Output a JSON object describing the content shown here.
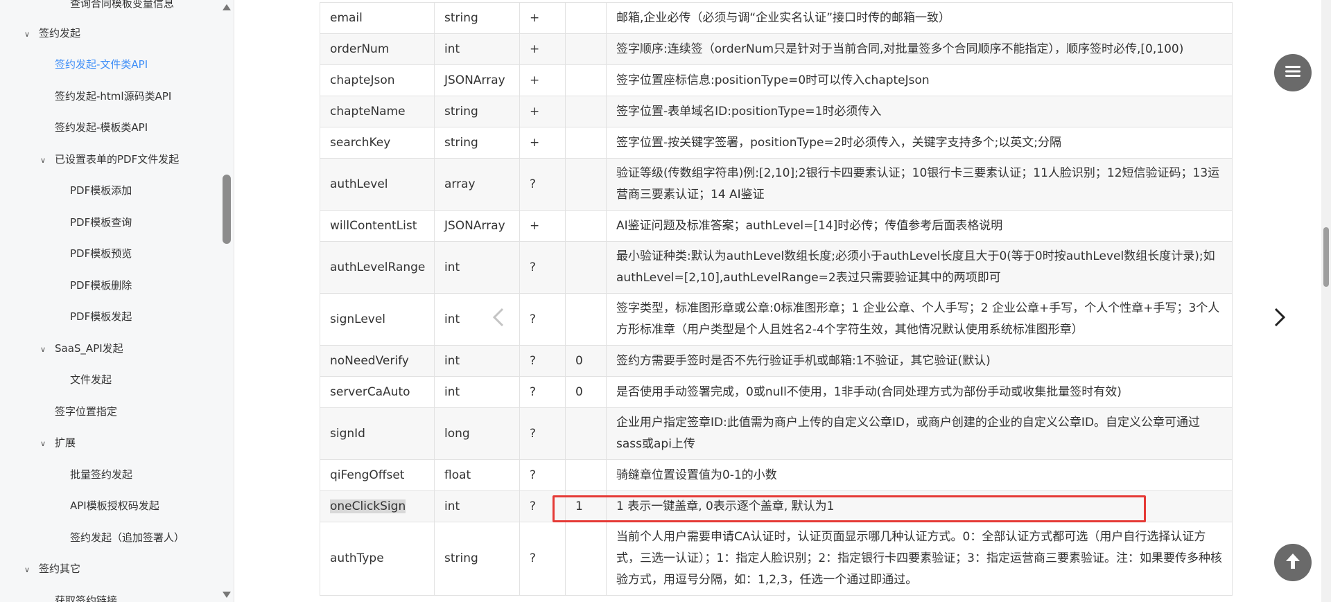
{
  "sidebar": {
    "items": [
      {
        "label": "查询合同模板变量信息",
        "level": 3,
        "chev": "",
        "active": false
      },
      {
        "label": "签约发起",
        "level": 1,
        "chev": "expanded",
        "active": false
      },
      {
        "label": "签约发起-文件类API",
        "level": 2,
        "chev": "",
        "active": true
      },
      {
        "label": "签约发起-html源码类API",
        "level": 2,
        "chev": "",
        "active": false
      },
      {
        "label": "签约发起-模板类API",
        "level": 2,
        "chev": "",
        "active": false
      },
      {
        "label": "已设置表单的PDF文件发起",
        "level": 2,
        "chev": "expanded",
        "active": false
      },
      {
        "label": "PDF模板添加",
        "level": 3,
        "chev": "",
        "active": false
      },
      {
        "label": "PDF模板查询",
        "level": 3,
        "chev": "",
        "active": false
      },
      {
        "label": "PDF模板预览",
        "level": 3,
        "chev": "",
        "active": false
      },
      {
        "label": "PDF模板删除",
        "level": 3,
        "chev": "",
        "active": false
      },
      {
        "label": "PDF模板发起",
        "level": 3,
        "chev": "",
        "active": false
      },
      {
        "label": "SaaS_API发起",
        "level": 2,
        "chev": "expanded",
        "active": false
      },
      {
        "label": "文件发起",
        "level": 3,
        "chev": "",
        "active": false
      },
      {
        "label": "签字位置指定",
        "level": 2,
        "chev": "",
        "active": false
      },
      {
        "label": "扩展",
        "level": 2,
        "chev": "expanded",
        "active": false
      },
      {
        "label": "批量签约发起",
        "level": 3,
        "chev": "",
        "active": false
      },
      {
        "label": "API模板授权码发起",
        "level": 3,
        "chev": "",
        "active": false
      },
      {
        "label": "签约发起（追加签署人）",
        "level": 3,
        "chev": "",
        "active": false
      },
      {
        "label": "签约其它",
        "level": 1,
        "chev": "expanded",
        "active": false
      },
      {
        "label": "获取签约链接",
        "level": 3,
        "chev": "",
        "active": false
      }
    ]
  },
  "table": {
    "rows": [
      {
        "name": "email",
        "type": "string",
        "required": "+",
        "default": "",
        "desc": "邮箱,企业必传（必须与调“企业实名认证”接口时传的邮箱一致）"
      },
      {
        "name": "orderNum",
        "type": "int",
        "required": "+",
        "default": "",
        "desc": "签字顺序:连续签（orderNum只是针对于当前合同,对批量签多个合同顺序不能指定），顺序签时必传,[0,100)"
      },
      {
        "name": "chapteJson",
        "type": "JSONArray",
        "required": "+",
        "default": "",
        "desc": "签字位置座标信息:positionType=0时可以传入chapteJson"
      },
      {
        "name": "chapteName",
        "type": "string",
        "required": "+",
        "default": "",
        "desc": "签字位置-表单域名ID:positionType=1时必须传入"
      },
      {
        "name": "searchKey",
        "type": "string",
        "required": "+",
        "default": "",
        "desc": "签字位置-按关键字签署，positionType=2时必须传入，关键字支持多个;以英文;分隔"
      },
      {
        "name": "authLevel",
        "type": "array",
        "required": "?",
        "default": "",
        "desc": "验证等级(传数组字符串)例:[2,10];2银行卡四要素认证；10银行卡三要素认证；11人脸识别；12短信验证码；13运营商三要素认证；14 AI鉴证"
      },
      {
        "name": "willContentList",
        "type": "JSONArray",
        "required": "+",
        "default": "",
        "desc": "AI鉴证问题及标准答案；authLevel=[14]时必传；传值参考后面表格说明"
      },
      {
        "name": "authLevelRange",
        "type": "int",
        "required": "?",
        "default": "",
        "desc": "最小验证种类:默认为authLevel数组长度;必须小于authLevel长度且大于0(等于0时按authLevel数组长度计录);如authLevel=[2,10],authLevelRange=2表过只需要验证其中的两项即可"
      },
      {
        "name": "signLevel",
        "type": "int",
        "required": "?",
        "default": "",
        "desc": "签字类型，标准图形章或公章:0标准图形章；1 企业公章、个人手写；2 企业公章+手写，个人个性章+手写；3个人方形标准章（用户类型是个人且姓名2-4个字符生效，其他情况默认使用系统标准图形章）"
      },
      {
        "name": "noNeedVerify",
        "type": "int",
        "required": "?",
        "default": "0",
        "desc": "签约方需要手签时是否不先行验证手机或邮箱:1不验证，其它验证(默认)"
      },
      {
        "name": "serverCaAuto",
        "type": "int",
        "required": "?",
        "default": "0",
        "desc": "是否使用手动签署完成，0或null不使用，1非手动(合同处理方式为部份手动或收集批量签时有效)"
      },
      {
        "name": "signId",
        "type": "long",
        "required": "?",
        "default": "",
        "desc": "企业用户指定签章ID:此值需为商户上传的自定义公章ID，或商户创建的企业的自定义公章ID。自定义公章可通过sass或api上传"
      },
      {
        "name": "qiFengOffset",
        "type": "float",
        "required": "?",
        "default": "",
        "desc": "骑缝章位置设置值为0-1的小数"
      },
      {
        "name": "oneClickSign",
        "type": "int",
        "required": "?",
        "default": "1",
        "desc": "1 表示一键盖章, 0表示逐个盖章, 默认为1"
      },
      {
        "name": "authType",
        "type": "string",
        "required": "?",
        "default": "",
        "desc": "当前个人用户需要申请CA认证时，认证页面显示哪几种认证方式。0：全部认证方式都可选（用户自行选择认证方式，三选一认证）；1：指定人脸识别；2：指定银行卡四要素验证；3：指定运营商三要素验证。注：如果要传多种核验方式，用逗号分隔，如：1,2,3，任选一个通过即通过。"
      }
    ]
  },
  "icons": {
    "prev": "chevron-left-icon",
    "next": "chevron-right-icon",
    "menu": "menu-icon",
    "back_to_top": "arrow-up-icon"
  },
  "colors": {
    "active_link": "#3e8ef7",
    "highlight_box": "#e53935",
    "fab_bg": "#6a6a6a"
  }
}
